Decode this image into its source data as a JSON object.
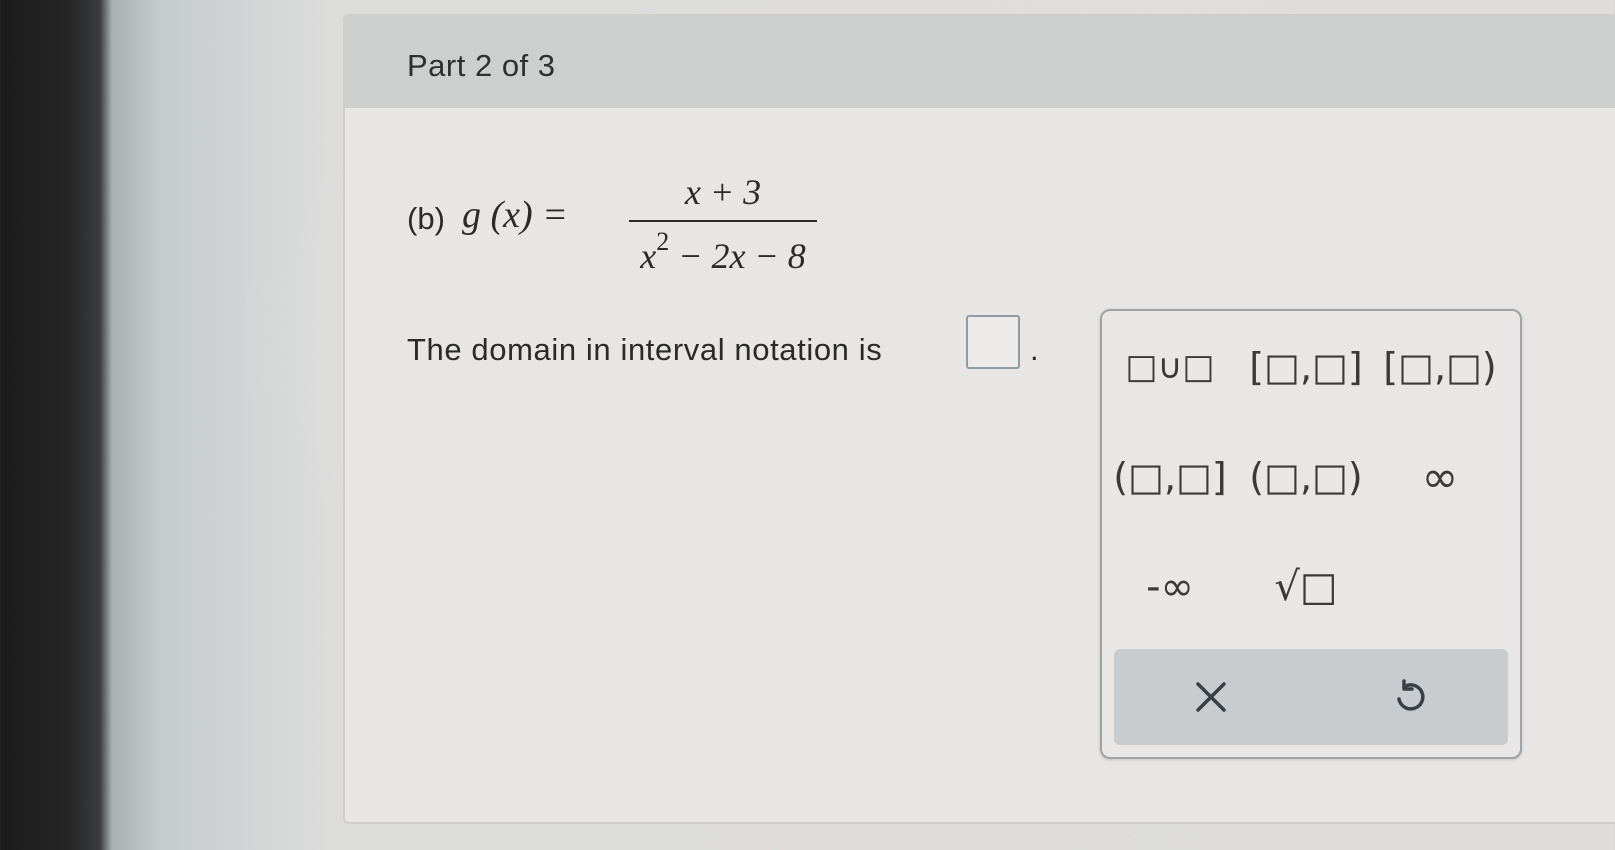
{
  "header": {
    "part_title": "Part 2 of 3"
  },
  "problem": {
    "label": "(b)",
    "function_name": "g (x) =",
    "numerator": "x + 3",
    "denominator_base": "x",
    "denominator_exponent": "2",
    "denominator_rest": "− 2x − 8"
  },
  "prompt": {
    "text": "The domain in interval notation is",
    "answer_value": "",
    "period": "."
  },
  "palette": {
    "buttons": [
      {
        "label": "□∪□",
        "icon": "union-icon"
      },
      {
        "label": "[□,□]",
        "icon": "closed-interval-icon"
      },
      {
        "label": "[□,□)",
        "icon": "half-open-right-interval-icon"
      },
      {
        "label": "(□,□]",
        "icon": "half-open-left-interval-icon"
      },
      {
        "label": "(□,□)",
        "icon": "open-interval-icon"
      },
      {
        "label": "∞",
        "icon": "infinity-icon"
      },
      {
        "label": "-∞",
        "icon": "negative-infinity-icon"
      },
      {
        "label": "√□",
        "icon": "square-root-icon"
      }
    ],
    "tray": {
      "clear_icon": "close-icon",
      "undo_icon": "undo-icon"
    }
  }
}
